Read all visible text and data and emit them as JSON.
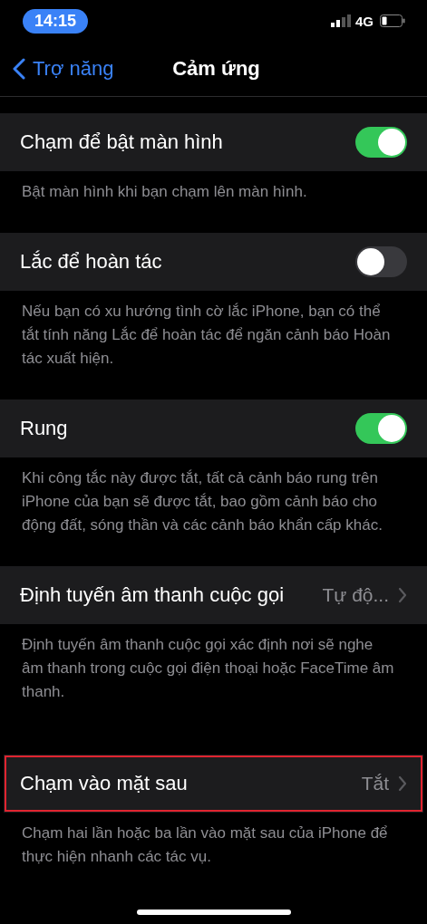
{
  "status_bar": {
    "time": "14:15",
    "network": "4G"
  },
  "nav": {
    "back": "Trợ năng",
    "title": "Cảm ứng"
  },
  "sections": [
    {
      "kind": "toggle",
      "label": "Chạm để bật màn hình",
      "on": true,
      "highlighted": false,
      "footer": "Bật màn hình khi bạn chạm lên màn hình."
    },
    {
      "kind": "toggle",
      "label": "Lắc để hoàn tác",
      "on": false,
      "highlighted": false,
      "footer": "Nếu bạn có xu hướng tình cờ lắc iPhone, bạn có thể tắt tính năng Lắc để hoàn tác để ngăn cảnh báo Hoàn tác xuất hiện."
    },
    {
      "kind": "toggle",
      "label": "Rung",
      "on": true,
      "highlighted": false,
      "footer": "Khi công tắc này được tắt, tất cả cảnh báo rung trên iPhone của bạn sẽ được tắt, bao gồm cảnh báo cho động đất, sóng thần và các cảnh báo khẩn cấp khác."
    },
    {
      "kind": "link",
      "label": "Định tuyến âm thanh cuộc gọi",
      "value": "Tự độ...",
      "highlighted": false,
      "footer": "Định tuyến âm thanh cuộc gọi xác định nơi sẽ nghe âm thanh trong cuộc gọi điện thoại hoặc FaceTime âm thanh."
    },
    {
      "kind": "link",
      "label": "Chạm vào mặt sau",
      "value": "Tắt",
      "highlighted": true,
      "footer": "Chạm hai lần hoặc ba lần vào mặt sau của iPhone để thực hiện nhanh các tác vụ."
    }
  ]
}
